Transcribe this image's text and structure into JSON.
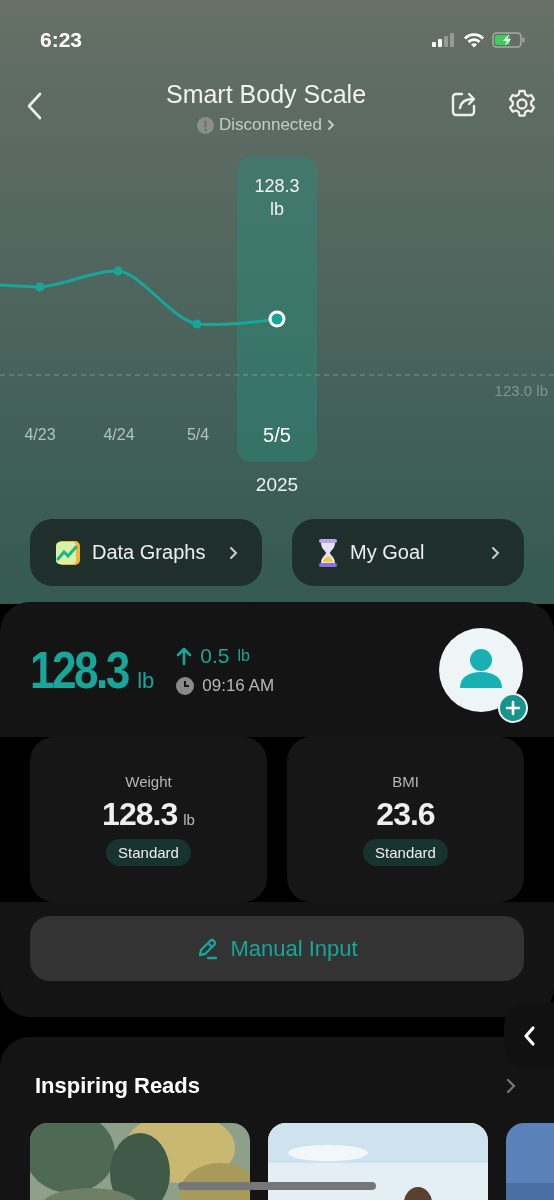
{
  "status_bar": {
    "time": "6:23"
  },
  "header": {
    "title": "Smart Body Scale",
    "connection": "Disconnected"
  },
  "chart": {
    "selected_reading": "128.3 lb",
    "reference_label": "123.0 lb",
    "year": "2025",
    "dates": [
      {
        "label": "4/23",
        "selected": false
      },
      {
        "label": "4/24",
        "selected": false
      },
      {
        "label": "5/4",
        "selected": false
      },
      {
        "label": "5/5",
        "selected": true
      }
    ]
  },
  "shortcuts": [
    {
      "label": "Data Graphs",
      "kind": "graphs"
    },
    {
      "label": "My Goal",
      "kind": "goal"
    }
  ],
  "latest": {
    "weight": "128.3",
    "unit": "lb",
    "change": "0.5",
    "change_unit": "lb",
    "increase": true,
    "time": "09:16 AM"
  },
  "metrics": [
    {
      "label": "Weight",
      "value": "128.3",
      "unit": "lb",
      "status": "Standard"
    },
    {
      "label": "BMI",
      "value": "23.6",
      "status": "Standard"
    }
  ],
  "manual_input": {
    "label": "Manual Input"
  },
  "reads": {
    "title": "Inspiring Reads"
  }
}
